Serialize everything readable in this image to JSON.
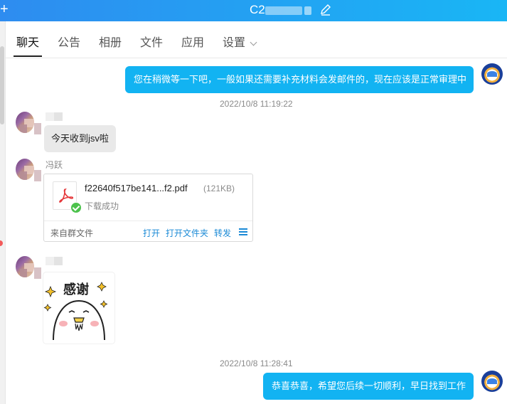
{
  "header": {
    "title": "C2",
    "plus_glyph": "+",
    "edit_icon": "edit-icon"
  },
  "tabs": [
    {
      "label": "聊天",
      "active": true
    },
    {
      "label": "公告"
    },
    {
      "label": "相册"
    },
    {
      "label": "文件"
    },
    {
      "label": "应用"
    },
    {
      "label": "设置"
    }
  ],
  "messages": {
    "m1": {
      "text": "您在稍微等一下吧，一般如果还需要补充材料会发邮件的，现在应该是正常审理中"
    },
    "ts1": "2022/10/8 11:19:22",
    "m2": {
      "text": "今天收到jsv啦"
    },
    "m3": {
      "sender": "冯跃",
      "file_name": "f22640f517be141...f2.pdf",
      "file_size": "(121KB)",
      "status": "下载成功",
      "source": "来自群文件",
      "actions": [
        "打开",
        "打开文件夹",
        "转发"
      ]
    },
    "m4": {
      "sticker_text": "感谢"
    },
    "ts2": "2022/10/8 11:28:41",
    "m5": {
      "text": "恭喜恭喜，希望您后续一切顺利，早日找到工作"
    }
  },
  "icons": {
    "file_type": "pdf-icon",
    "download_status": "check-circle-icon",
    "more_menu": "menu-lines-icon",
    "settings_dropdown": "chevron-down-icon"
  },
  "colors": {
    "header_start": "#2e8cf0",
    "header_end": "#19b6f5",
    "my_bubble": "#12b3f2",
    "other_bubble": "#e9e9e9",
    "link": "#1b8ad6",
    "success": "#4cc24c"
  }
}
